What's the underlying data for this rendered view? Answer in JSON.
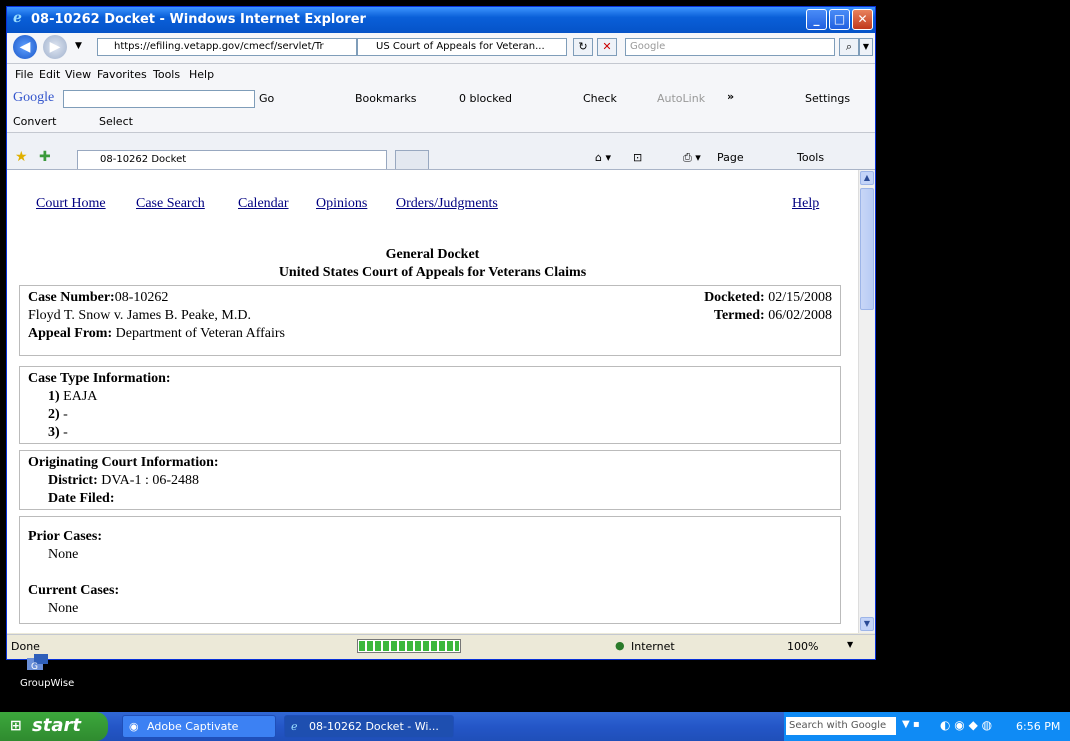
{
  "window": {
    "title": "08-10262 Docket - Windows Internet Explorer",
    "url": "https://efiling.vetapp.gov/cmecf/servlet/Tr",
    "site_tab": "US Court of Appeals for Veteran...",
    "search_placeholder": "Google"
  },
  "menu": [
    "File",
    "Edit",
    "View",
    "Favorites",
    "Tools",
    "Help"
  ],
  "google_toolbar": {
    "logo": "Google",
    "go": "Go",
    "bookmarks": "Bookmarks",
    "blocked": "0 blocked",
    "check": "Check",
    "autolink": "AutoLink",
    "settings": "Settings"
  },
  "convert_bar": {
    "convert": "Convert",
    "select": "Select"
  },
  "tab": {
    "label": "08-10262 Docket"
  },
  "tab_tools": {
    "page": "Page",
    "tools": "Tools"
  },
  "page": {
    "nav": [
      "Court Home",
      "Case Search",
      "Calendar",
      "Opinions",
      "Orders/Judgments",
      "Help"
    ],
    "heading1": "General Docket",
    "heading2": "United States Court of Appeals for Veterans Claims",
    "case": {
      "number_label": "Case Number:",
      "number": "08-10262",
      "parties": "Floyd T. Snow v. James B. Peake, M.D.",
      "appeal_label": "Appeal From:",
      "appeal": "Department of Veteran Affairs",
      "docketed_label": "Docketed:",
      "docketed": "02/15/2008",
      "termed_label": "Termed:",
      "termed": "06/02/2008"
    },
    "case_type": {
      "label": "Case Type Information:",
      "items": [
        {
          "n": "1)",
          "v": "EAJA"
        },
        {
          "n": "2)",
          "v": "-"
        },
        {
          "n": "3)",
          "v": "-"
        }
      ]
    },
    "originating": {
      "label": "Originating Court Information:",
      "district_label": "District:",
      "district": "DVA-1 : 06-2488",
      "date_label": "Date Filed:"
    },
    "prior": {
      "label": "Prior Cases:",
      "value": "None"
    },
    "current": {
      "label": "Current Cases:",
      "value": "None"
    }
  },
  "status": {
    "text": "Done",
    "zone": "Internet",
    "zoom": "100%",
    "progress": 1.0
  },
  "desktop": {
    "icon_label": "GroupWise"
  },
  "taskbar": {
    "start": "start",
    "items": [
      "Adobe Captivate",
      "08-10262 Docket - Wi..."
    ],
    "search": "Search with Google",
    "time": "6:56 PM"
  },
  "colors": {
    "titlebar": "#0a5fd8",
    "link": "#000080",
    "taskbar": "#2456c7",
    "start": "#3ca83c"
  }
}
